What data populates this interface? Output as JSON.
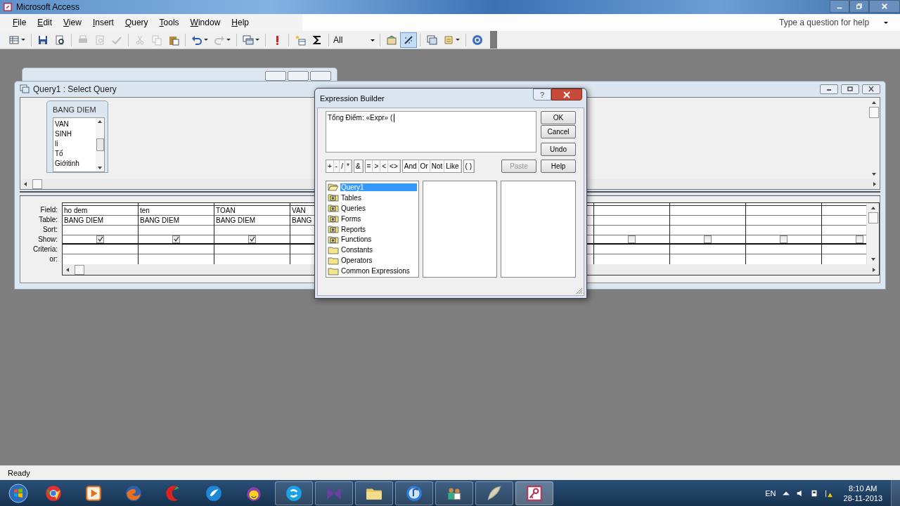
{
  "window": {
    "title": "Microsoft Access"
  },
  "menu": [
    "File",
    "Edit",
    "View",
    "Insert",
    "Query",
    "Tools",
    "Window",
    "Help"
  ],
  "help_box": {
    "placeholder": "Type a question for help"
  },
  "toolbar": [
    {
      "kind": "view",
      "menu": true,
      "disabled": false,
      "pressed": false
    },
    {
      "kind": "separator"
    },
    {
      "kind": "save",
      "menu": false,
      "disabled": false,
      "pressed": false
    },
    {
      "kind": "search",
      "menu": false,
      "disabled": false,
      "pressed": false
    },
    {
      "kind": "separator"
    },
    {
      "kind": "print",
      "menu": false,
      "disabled": true,
      "pressed": false
    },
    {
      "kind": "preview",
      "menu": false,
      "disabled": true,
      "pressed": false
    },
    {
      "kind": "spelling",
      "menu": false,
      "disabled": true,
      "pressed": false
    },
    {
      "kind": "separator"
    },
    {
      "kind": "cut",
      "menu": false,
      "disabled": true,
      "pressed": false
    },
    {
      "kind": "copy",
      "menu": false,
      "disabled": true,
      "pressed": false
    },
    {
      "kind": "paste",
      "menu": false,
      "disabled": false,
      "pressed": false
    },
    {
      "kind": "separator"
    },
    {
      "kind": "undo",
      "menu": true,
      "disabled": false,
      "pressed": false
    },
    {
      "kind": "redo",
      "menu": true,
      "disabled": true,
      "pressed": false
    },
    {
      "kind": "separator"
    },
    {
      "kind": "query-type",
      "menu": true,
      "disabled": false,
      "pressed": false
    },
    {
      "kind": "separator"
    },
    {
      "kind": "run",
      "menu": false,
      "disabled": false,
      "pressed": false
    },
    {
      "kind": "separator"
    },
    {
      "kind": "show-table",
      "menu": false,
      "disabled": false,
      "pressed": false
    },
    {
      "kind": "totals",
      "menu": false,
      "disabled": false,
      "pressed": false
    },
    {
      "kind": "separator"
    },
    {
      "kind": "combo",
      "value": "All"
    },
    {
      "kind": "separator"
    },
    {
      "kind": "properties",
      "menu": false,
      "disabled": false,
      "pressed": false
    },
    {
      "kind": "builder",
      "menu": false,
      "disabled": false,
      "pressed": true
    },
    {
      "kind": "separator"
    },
    {
      "kind": "database",
      "menu": false,
      "disabled": false,
      "pressed": false
    },
    {
      "kind": "new-object",
      "menu": true,
      "disabled": false,
      "pressed": false
    },
    {
      "kind": "separator"
    },
    {
      "kind": "help",
      "menu": false,
      "disabled": false,
      "pressed": false
    }
  ],
  "query_window": {
    "title": "Query1 : Select Query",
    "table": {
      "name": "BANG DIEM",
      "fields": [
        "VAN",
        "SINH",
        "li",
        "Tố",
        "Giớitinh"
      ]
    },
    "row_labels": [
      "Field:",
      "Table:",
      "Sort:",
      "Show:",
      "Criteria:",
      "or:"
    ],
    "columns": [
      {
        "field": "ho dem",
        "table": "BANG DIEM",
        "show": true
      },
      {
        "field": "ten",
        "table": "BANG DIEM",
        "show": true
      },
      {
        "field": "TOAN",
        "table": "BANG DIEM",
        "show": true
      },
      {
        "field": "VAN",
        "table": "BANG"
      }
    ],
    "columns_right": [
      {
        "show": false
      },
      {
        "show": false
      },
      {
        "show": false
      },
      {
        "show": false
      }
    ]
  },
  "dialog": {
    "title": "Expression Builder",
    "help_glyph": "?",
    "expression": "Tổng Điểm: «Expr» (",
    "buttons": [
      "OK",
      "Cancel",
      "Undo"
    ],
    "help_button": "Help",
    "operator_groups": [
      [
        "+",
        "-",
        "/",
        "*"
      ],
      [
        "&"
      ],
      [
        "=",
        ">",
        "<",
        "<>"
      ],
      [
        "And",
        "Or",
        "Not",
        "Like"
      ],
      [
        "( )"
      ]
    ],
    "paste": {
      "label": "Paste",
      "disabled": true
    },
    "tree": [
      {
        "label": "Query1",
        "kind": "open",
        "selected": true
      },
      {
        "label": "Tables",
        "kind": "plus",
        "selected": false
      },
      {
        "label": "Queries",
        "kind": "plus",
        "selected": false
      },
      {
        "label": "Forms",
        "kind": "plus",
        "selected": false
      },
      {
        "label": "Reports",
        "kind": "plus",
        "selected": false
      },
      {
        "label": "Functions",
        "kind": "plus",
        "selected": false
      },
      {
        "label": "Constants",
        "kind": "folder",
        "selected": false
      },
      {
        "label": "Operators",
        "kind": "folder",
        "selected": false
      },
      {
        "label": "Common Expressions",
        "kind": "folder",
        "selected": false
      }
    ]
  },
  "status_bar": "Ready",
  "taskbar": {
    "apps": [
      {
        "running": false,
        "active": false
      },
      {
        "running": false,
        "active": false
      },
      {
        "running": false,
        "active": false
      },
      {
        "running": false,
        "active": false
      },
      {
        "running": false,
        "active": false
      },
      {
        "running": false,
        "active": false
      },
      {
        "running": true,
        "active": false
      },
      {
        "running": true,
        "active": false
      },
      {
        "running": true,
        "active": false
      },
      {
        "running": true,
        "active": false
      },
      {
        "running": true,
        "active": false
      },
      {
        "running": true,
        "active": false
      },
      {
        "running": true,
        "active": true
      }
    ],
    "language": "EN",
    "time": "8:10 AM",
    "date": "28-11-2013"
  }
}
